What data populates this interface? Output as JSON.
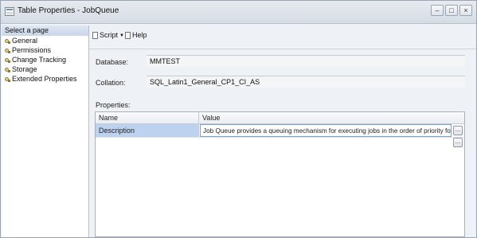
{
  "window": {
    "title": "Table Properties - JobQueue",
    "controls": {
      "minimize": "–",
      "maximize": "□",
      "close": "×"
    }
  },
  "left_pane": {
    "header": "Select a page",
    "items": [
      {
        "label": "General",
        "icon": "wrench-icon"
      },
      {
        "label": "Permissions",
        "icon": "wrench-icon"
      },
      {
        "label": "Change Tracking",
        "icon": "wrench-icon"
      },
      {
        "label": "Storage",
        "icon": "wrench-icon"
      },
      {
        "label": "Extended Properties",
        "icon": "wrench-icon"
      }
    ]
  },
  "toolbar": {
    "script_label": "Script",
    "help_label": "Help"
  },
  "fields": {
    "database_label": "Database:",
    "database_value": "MMTEST",
    "collation_label": "Collation:",
    "collation_value": "SQL_Latin1_General_CP1_CI_AS"
  },
  "properties": {
    "label": "Properties:",
    "columns": [
      "Name",
      "Value"
    ],
    "rows": [
      {
        "name": "Description",
        "value": "Job Queue provides a queuing mechanism for executing jobs in the order of priority for a given group of Jobs."
      }
    ],
    "ellipsis": "..."
  },
  "colors": {
    "selected_row": "#bcd2ee",
    "window_bg": "#eef1f5"
  }
}
